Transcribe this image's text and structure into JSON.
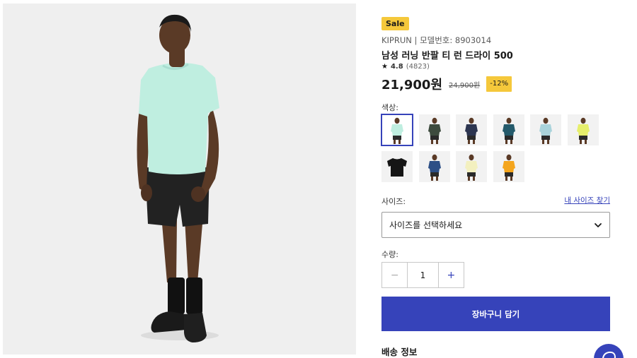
{
  "product": {
    "sale_badge": "Sale",
    "brand_line": "KIPRUN | 모델번호: 8903014",
    "title": "남성 러닝 반팔 티 런 드라이 500",
    "rating": {
      "star": "★",
      "score": "4.8",
      "count": "(4823)"
    },
    "price": {
      "current": "21,900원",
      "original": "24,900원",
      "discount": "-12%"
    }
  },
  "color": {
    "label": "색상:",
    "swatches": [
      {
        "name": "mint",
        "shirt": "#bfeee0",
        "shorts": "#2a2a2a",
        "selected": true
      },
      {
        "name": "dark-green",
        "shirt": "#3d4b3e",
        "shorts": "#2a2a2a"
      },
      {
        "name": "navy",
        "shirt": "#2c3550",
        "shorts": "#2a2a2a"
      },
      {
        "name": "teal",
        "shirt": "#245a6b",
        "shorts": "#2a2a2a"
      },
      {
        "name": "light-blue",
        "shirt": "#a9d3db",
        "shorts": "#2a2a2a"
      },
      {
        "name": "lime",
        "shirt": "#e6ef6c",
        "shorts": "#2a2a2a"
      },
      {
        "name": "black",
        "shirt": "#151515",
        "shorts": "#151515",
        "flat": true
      },
      {
        "name": "blue",
        "shirt": "#2d4f86",
        "shorts": "#2a2a2a"
      },
      {
        "name": "cream",
        "shirt": "#f3f0bf",
        "shorts": "#2a2a2a"
      },
      {
        "name": "orange",
        "shirt": "#f4a51d",
        "shorts": "#2a2a2a"
      }
    ]
  },
  "size": {
    "label": "사이즈:",
    "guide_link": "내 사이즈 찾기",
    "select_value": "사이즈를 선택하세요"
  },
  "quantity": {
    "label": "수량:",
    "minus": "−",
    "value": "1",
    "plus": "+"
  },
  "cart": {
    "button_label": "장바구니 담기"
  },
  "shipping": {
    "heading": "배송 정보"
  },
  "colors": {
    "accent": "#3643ba",
    "badge": "#f5c83b",
    "image_bg": "#efefef"
  },
  "icons": {
    "select_chevron": "chevron-down-icon",
    "chat": "chat-icon"
  }
}
